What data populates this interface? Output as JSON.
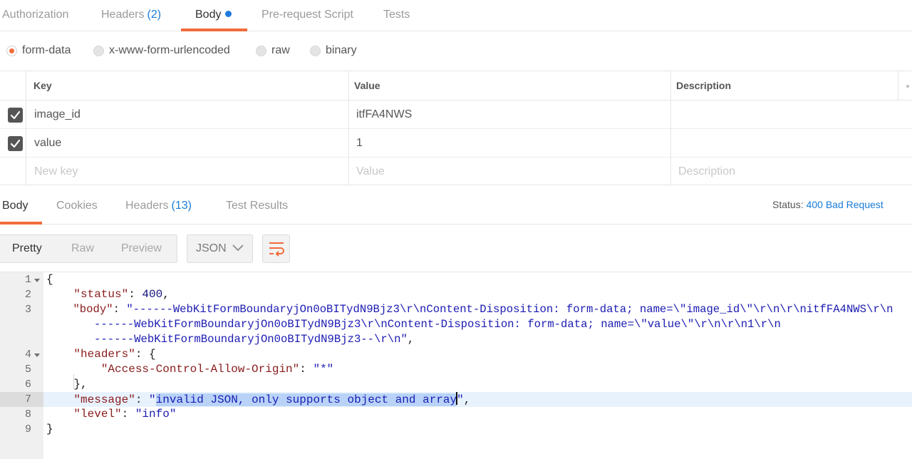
{
  "request_tabs": {
    "authorization": "Authorization",
    "headers": "Headers",
    "headers_count": "(2)",
    "body": "Body",
    "prerequest": "Pre-request Script",
    "tests": "Tests"
  },
  "body_types": {
    "form_data": "form-data",
    "urlencoded": "x-www-form-urlencoded",
    "raw": "raw",
    "binary": "binary",
    "selected": "form-data"
  },
  "kv_table": {
    "headers": {
      "key": "Key",
      "value": "Value",
      "description": "Description"
    },
    "rows": [
      {
        "checked": true,
        "key": "image_id",
        "value": "itfFA4NWS"
      },
      {
        "checked": true,
        "key": "value",
        "value": "1"
      }
    ],
    "placeholders": {
      "key": "New key",
      "value": "Value",
      "description": "Description"
    }
  },
  "response_tabs": {
    "body": "Body",
    "cookies": "Cookies",
    "headers": "Headers",
    "headers_count": "(13)",
    "test_results": "Test Results"
  },
  "status": {
    "label": "Status:",
    "value": "400 Bad Request"
  },
  "view_modes": {
    "pretty": "Pretty",
    "raw": "Raw",
    "preview": "Preview",
    "format": "JSON"
  },
  "code": {
    "line_numbers": [
      "1",
      "2",
      "3",
      "",
      "",
      "4",
      "5",
      "6",
      "7",
      "8",
      "9"
    ],
    "open_brace": "{",
    "status_key": "\"status\"",
    "status_val": "400",
    "body_key": "\"body\"",
    "body_line1": "\"------WebKitFormBoundaryjOn0oBITydN9Bjz3\\r\\nContent-Disposition: form-data; name=\\\"image_id\\\"\\r\\n\\r\\nitfFA4NWS\\r\\n",
    "body_line2": "------WebKitFormBoundaryjOn0oBITydN9Bjz3\\r\\nContent-Disposition: form-data; name=\\\"value\\\"\\r\\n\\r\\n1\\r\\n",
    "body_line3": "------WebKitFormBoundaryjOn0oBITydN9Bjz3--\\r\\n\"",
    "headers_key": "\"headers\"",
    "acao_key": "\"Access-Control-Allow-Origin\"",
    "acao_val": "\"*\"",
    "close_headers": "},",
    "message_key": "\"message\"",
    "message_quote": "\"",
    "message_val": "invalid JSON, only supports object and array",
    "level_key": "\"level\"",
    "level_val": "\"info\"",
    "close_brace": "}"
  },
  "colors": {
    "accent": "#f26b3a",
    "link": "#1a7bd6",
    "selection": "#b8d3f7"
  }
}
